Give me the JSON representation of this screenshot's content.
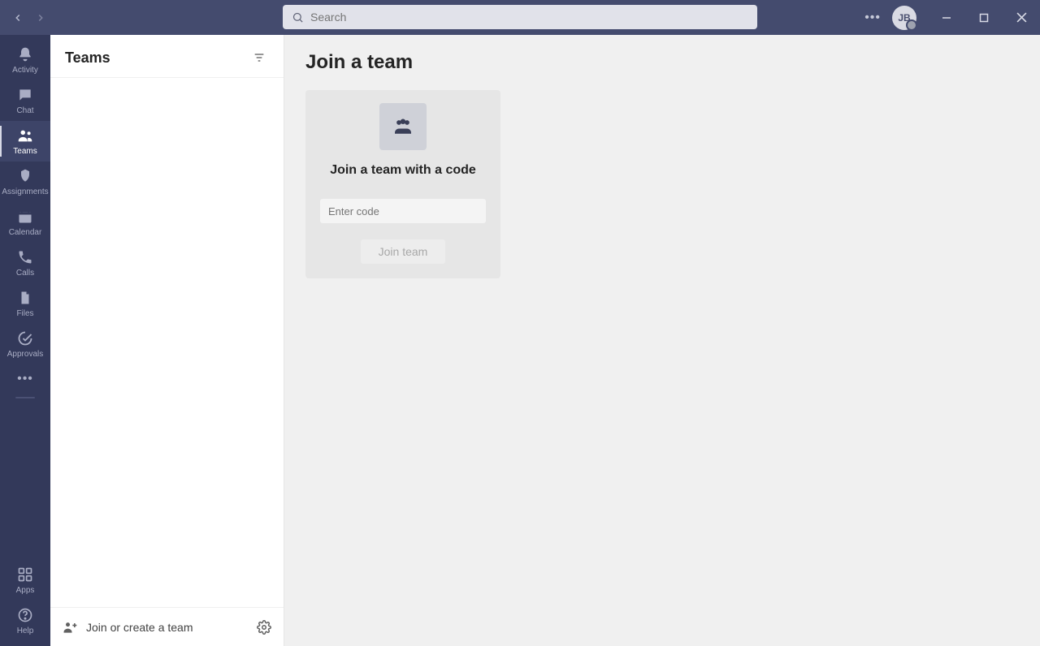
{
  "search": {
    "placeholder": "Search"
  },
  "avatar": {
    "initials": "JB"
  },
  "rail": {
    "items": [
      {
        "label": "Activity",
        "icon": "bell"
      },
      {
        "label": "Chat",
        "icon": "chat"
      },
      {
        "label": "Teams",
        "icon": "teams"
      },
      {
        "label": "Assignments",
        "icon": "assignments"
      },
      {
        "label": "Calendar",
        "icon": "calendar"
      },
      {
        "label": "Calls",
        "icon": "calls"
      },
      {
        "label": "Files",
        "icon": "files"
      },
      {
        "label": "Approvals",
        "icon": "approvals"
      }
    ],
    "bottom": [
      {
        "label": "Apps",
        "icon": "apps"
      },
      {
        "label": "Help",
        "icon": "help"
      }
    ]
  },
  "side": {
    "title": "Teams",
    "footer_link": "Join or create a team"
  },
  "content": {
    "heading": "Join a team",
    "card": {
      "title": "Join a team with a code",
      "placeholder": "Enter code",
      "button": "Join team"
    }
  }
}
